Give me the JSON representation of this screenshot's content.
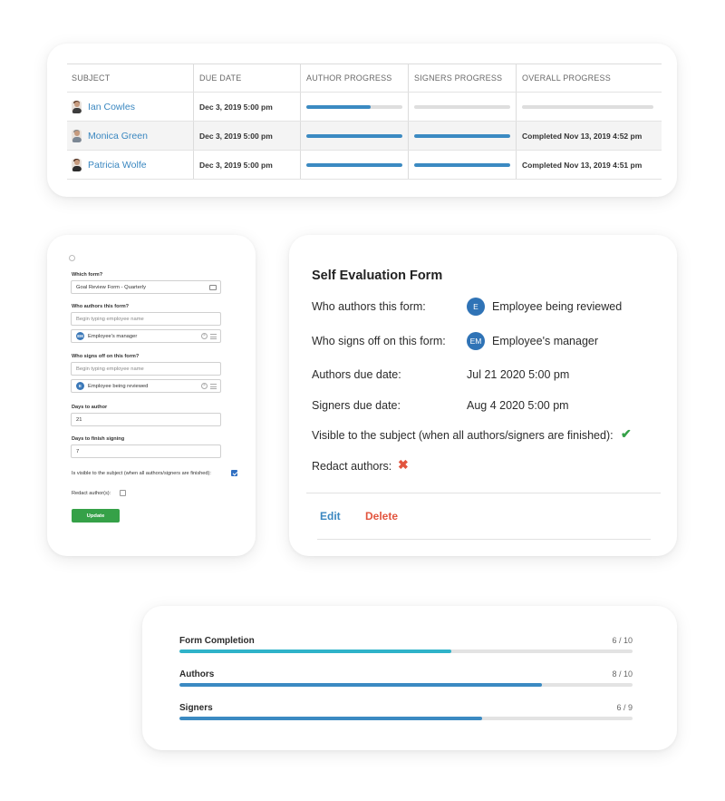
{
  "table": {
    "headers": [
      "SUBJECT",
      "DUE DATE",
      "AUTHOR PROGRESS",
      "SIGNERS PROGRESS",
      "OVERALL PROGRESS"
    ],
    "rows": [
      {
        "subject": "Ian Cowles",
        "due_date": "Dec 3, 2019 5:00 pm",
        "author_progress": 0.67,
        "signers_progress": 0.0,
        "overall_progress": 0.0,
        "overall_text": ""
      },
      {
        "subject": "Monica Green",
        "due_date": "Dec 3, 2019 5:00 pm",
        "author_progress": 1.0,
        "signers_progress": 1.0,
        "overall_progress": null,
        "overall_text": "Completed Nov 13, 2019 4:52 pm"
      },
      {
        "subject": "Patricia Wolfe",
        "due_date": "Dec 3, 2019 5:00 pm",
        "author_progress": 1.0,
        "signers_progress": 1.0,
        "overall_progress": null,
        "overall_text": "Completed Nov 13, 2019 4:51 pm"
      }
    ],
    "progress_color": "#3b8ac2"
  },
  "form": {
    "which_form_label": "Which form?",
    "which_form_value": "Goal Review Form - Quarterly",
    "authors_label": "Who authors this form?",
    "authors_placeholder": "Begin typing employee name",
    "authors_chip": {
      "initials": "EM",
      "text": "Employee's manager"
    },
    "signers_label": "Who signs off on this form?",
    "signers_placeholder": "Begin typing employee name",
    "signers_chip": {
      "initials": "E",
      "text": "Employee being reviewed"
    },
    "days_author_label": "Days to author",
    "days_author_value": "21",
    "days_sign_label": "Days to finish signing",
    "days_sign_value": "7",
    "visible_label": "Is visible to the subject (when all authors/signers are finished):",
    "visible_checked": true,
    "redact_label": "Redact author(s):",
    "redact_checked": false,
    "update_label": "Update",
    "update_color": "#35a148"
  },
  "detail": {
    "title": "Self Evaluation Form",
    "authors_label": "Who authors this form:",
    "authors_initials": "E",
    "authors_value": "Employee being reviewed",
    "signers_label": "Who signs off on this form:",
    "signers_initials": "EM",
    "signers_value": "Employee's manager",
    "authors_due_label": "Authors due date:",
    "authors_due_value": "Jul 21 2020 5:00 pm",
    "signers_due_label": "Signers due date:",
    "signers_due_value": "Aug 4 2020 5:00 pm",
    "visible_label": "Visible to the subject (when all authors/signers are finished):",
    "visible_icon": "check-icon",
    "redact_label": "Redact authors:",
    "redact_icon": "cross-icon",
    "edit_label": "Edit",
    "delete_label": "Delete",
    "edit_color": "#3b87c0",
    "delete_color": "#e2553f",
    "check_color": "#35a148",
    "cross_color": "#e2553f"
  },
  "progress": {
    "items": [
      {
        "label": "Form Completion",
        "count": "6 / 10",
        "value": 0.6,
        "color": "#2fb3c9"
      },
      {
        "label": "Authors",
        "count": "8 / 10",
        "value": 0.8,
        "color": "#3b8ac2"
      },
      {
        "label": "Signers",
        "count": "6 / 9",
        "value": 0.667,
        "color": "#3b8ac2"
      }
    ]
  }
}
